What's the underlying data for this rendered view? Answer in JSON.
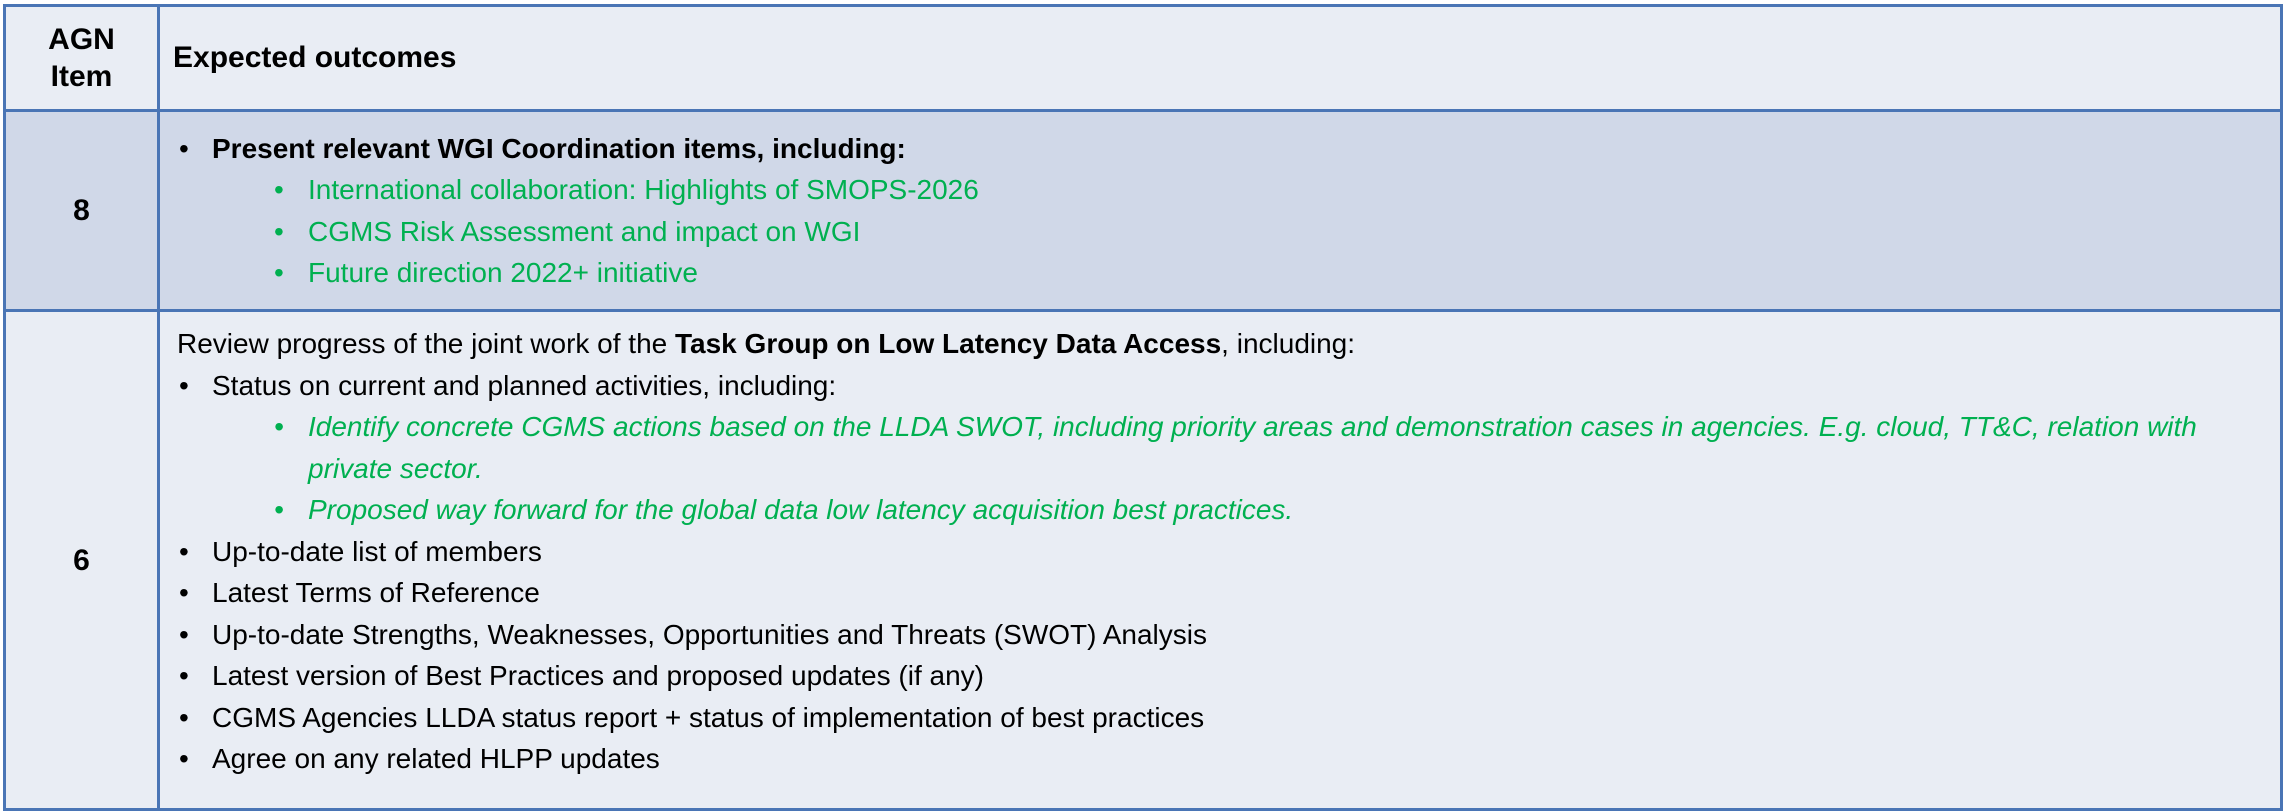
{
  "header": {
    "col1": "AGN Item",
    "col2": "Expected outcomes"
  },
  "row8": {
    "item": "8",
    "heading": "Present relevant WGI Coordination items, including:",
    "subitems": [
      "International collaboration: Highlights of SMOPS-2026",
      "CGMS Risk Assessment and impact on WGI",
      "Future direction 2022+ initiative"
    ]
  },
  "row6": {
    "item": "6",
    "intro_prefix": "Review progress of the joint work of the ",
    "intro_bold": "Task Group on Low Latency Data Access",
    "intro_suffix": ", including:",
    "status_heading": "Status on current and planned activities, including:",
    "status_subitems": [
      "Identify concrete CGMS actions based on the LLDA SWOT, including priority areas and demonstration cases in agencies. E.g. cloud, TT&C, relation with private sector.",
      "Proposed way forward for the global data low latency acquisition best practices."
    ],
    "bullets": [
      "Up-to-date list of members",
      "Latest Terms of Reference",
      "Up-to-date Strengths, Weaknesses, Opportunities and Threats (SWOT) Analysis",
      "Latest version of Best Practices and proposed updates (if any)",
      "CGMS Agencies LLDA status report + status of implementation of best practices",
      "Agree on any related HLPP updates"
    ]
  },
  "colors": {
    "border": "#4a75b5",
    "header_bg": "#e9edf4",
    "band_bg": "#d0d8e8",
    "green_text": "#00b050"
  }
}
